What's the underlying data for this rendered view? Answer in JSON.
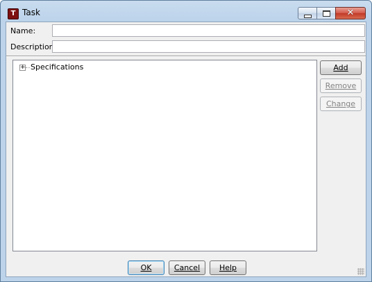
{
  "window": {
    "title": "Task",
    "icon_letter": "T",
    "caption_icons": [
      "minimize-icon",
      "maximize-icon",
      "close-icon"
    ]
  },
  "form": {
    "name_label": "Name:",
    "name_value": "",
    "description_label": "Description:",
    "description_value": ""
  },
  "tree": {
    "expander_glyph": "+",
    "items": [
      {
        "label": "Specifications",
        "expanded": false
      }
    ]
  },
  "side_buttons": {
    "add": "Add",
    "remove": "Remove",
    "change": "Change"
  },
  "footer_buttons": {
    "ok": "OK",
    "cancel": "Cancel",
    "help": "Help"
  },
  "colors": {
    "titlebar": "#bcd3ea",
    "client": "#f0f0f0",
    "close_button": "#c03a28",
    "app_icon": "#7e1010"
  }
}
